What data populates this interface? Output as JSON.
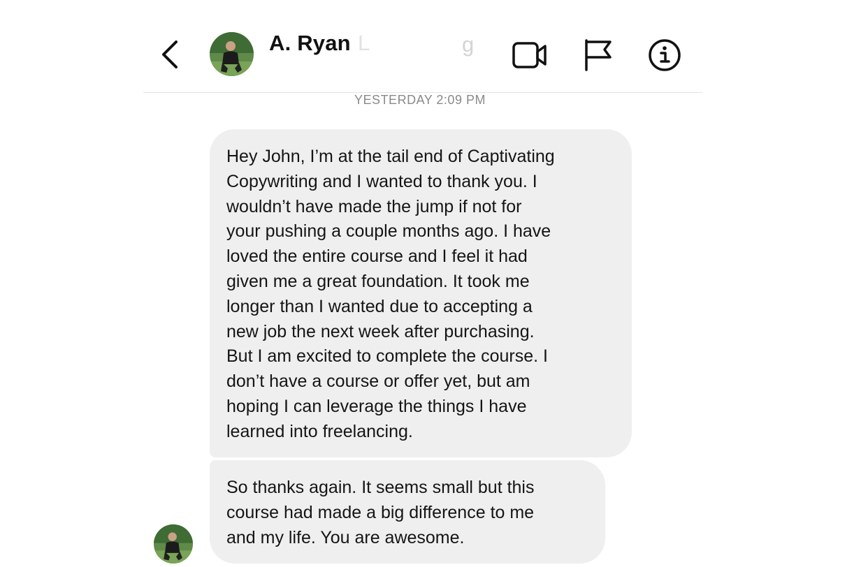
{
  "header": {
    "contact_name": "A. Ryan",
    "name_trailing_fragment_1": "L",
    "name_trailing_fragment_2": "g",
    "icons": [
      "chevron-left-icon",
      "video-camera-icon",
      "flag-icon",
      "info-icon"
    ]
  },
  "thread": {
    "timestamp": "YESTERDAY 2:09 PM",
    "messages": [
      {
        "lines": [
          "Hey John, I’m at the tail end of Captivating",
          "Copywriting and I wanted to thank you. I",
          "wouldn’t have made the jump if not for",
          "your pushing a couple months ago. I have",
          "loved the entire course and I feel it had",
          "given me a great foundation. It took me",
          "longer than I wanted due to accepting a",
          "new job the next week after purchasing.",
          "But I am excited to complete the course. I",
          "don’t have a course or offer yet, but am",
          "hoping I can leverage the things I have",
          "learned into freelancing."
        ]
      },
      {
        "lines": [
          "So thanks again. It seems small but this",
          "course had made a big difference to me",
          "and my life. You are awesome."
        ]
      }
    ]
  },
  "colors": {
    "bubble_background": "#efefef",
    "timestamp_text": "#8a8a8a",
    "divider": "#e3e3e3"
  }
}
